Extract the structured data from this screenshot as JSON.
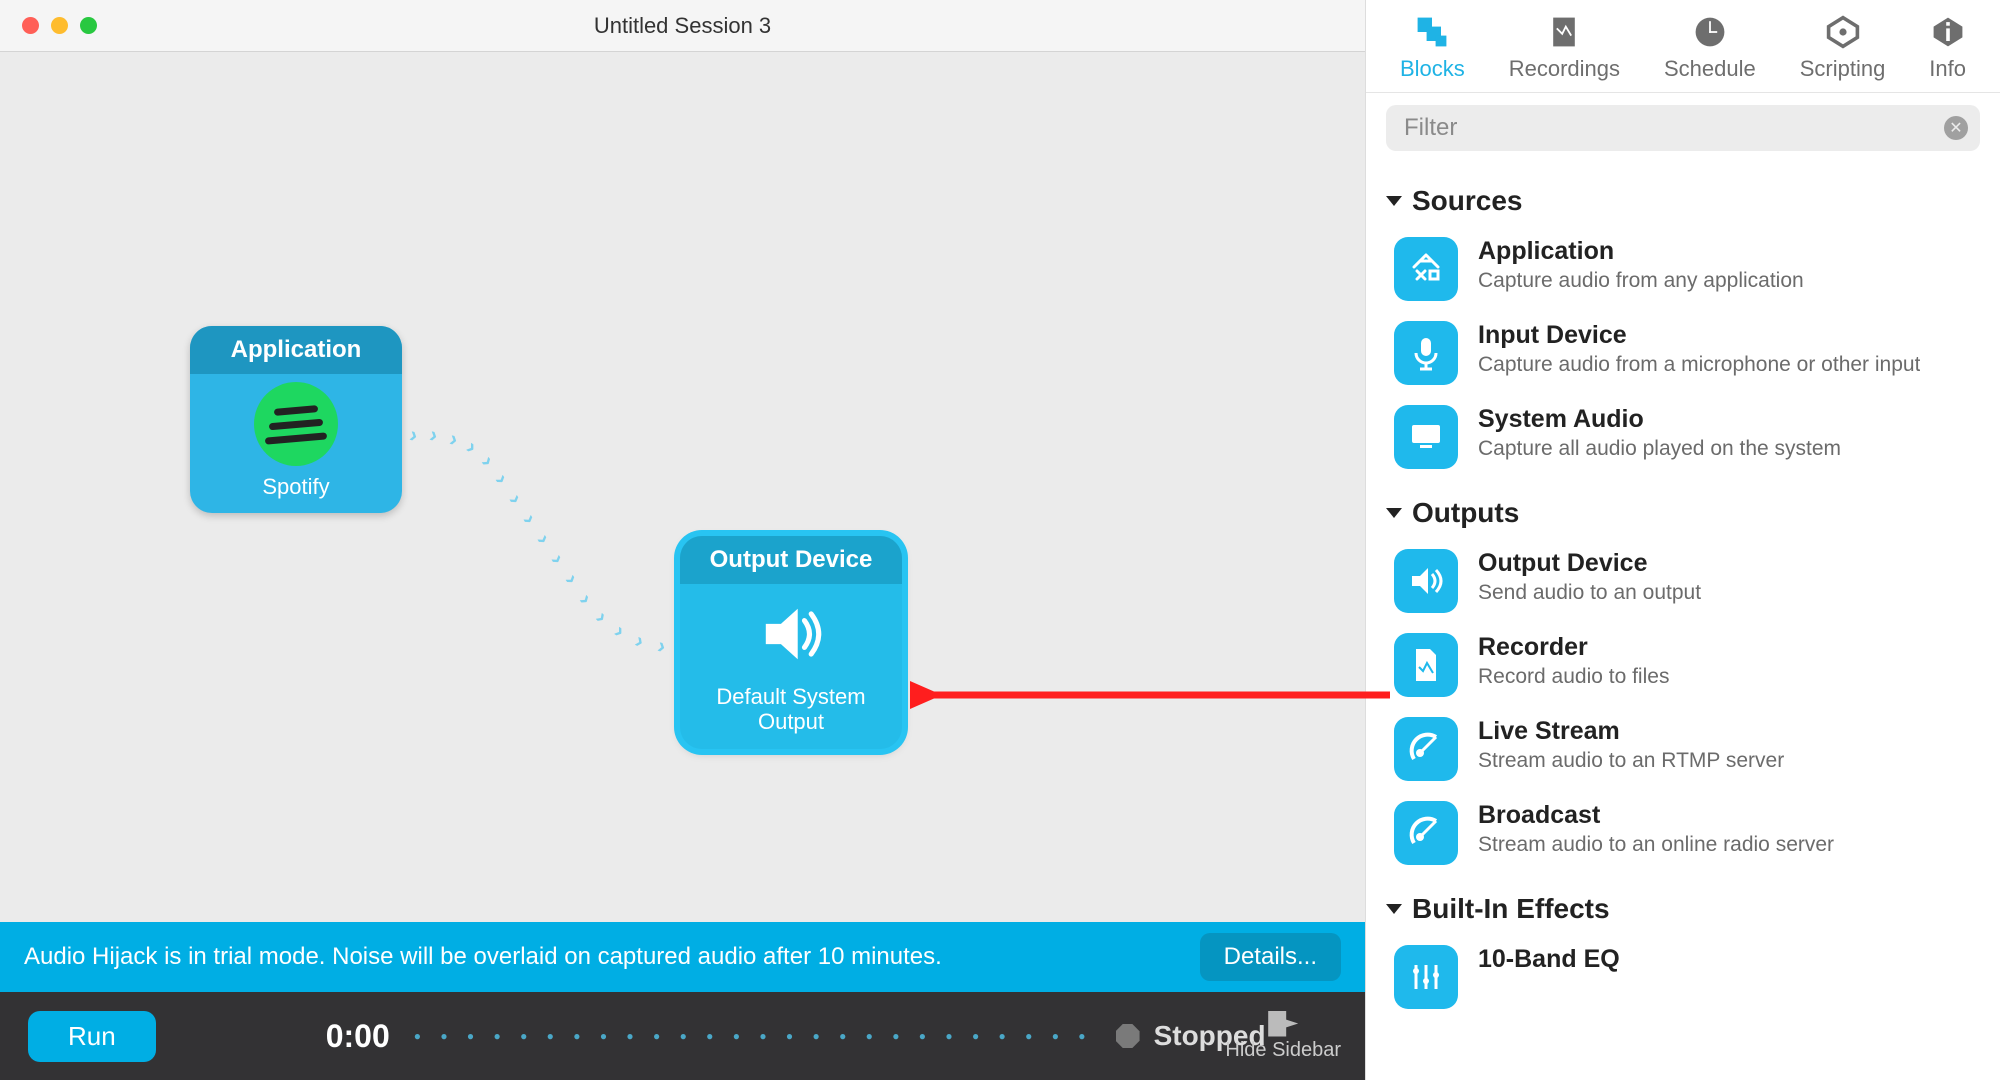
{
  "window": {
    "title": "Untitled Session 3"
  },
  "canvas": {
    "node1": {
      "header": "Application",
      "label": "Spotify"
    },
    "node2": {
      "header": "Output Device",
      "label": "Default System Output"
    }
  },
  "trial_bar": {
    "message": "Audio Hijack is in trial mode. Noise will be overlaid on captured audio after 10 minutes.",
    "details_label": "Details..."
  },
  "control_bar": {
    "run_label": "Run",
    "time": "0:00",
    "status": "Stopped",
    "hide_sidebar_label": "Hide Sidebar"
  },
  "sidebar_tabs": {
    "blocks": "Blocks",
    "recordings": "Recordings",
    "schedule": "Schedule",
    "scripting": "Scripting",
    "info": "Info"
  },
  "filter": {
    "placeholder": "Filter"
  },
  "sections": {
    "sources": {
      "title": "Sources",
      "items": [
        {
          "title": "Application",
          "desc": "Capture audio from any application"
        },
        {
          "title": "Input Device",
          "desc": "Capture audio from a microphone or other input"
        },
        {
          "title": "System Audio",
          "desc": "Capture all audio played on the system"
        }
      ]
    },
    "outputs": {
      "title": "Outputs",
      "items": [
        {
          "title": "Output Device",
          "desc": "Send audio to an output"
        },
        {
          "title": "Recorder",
          "desc": "Record audio to files"
        },
        {
          "title": "Live Stream",
          "desc": "Stream audio to an RTMP server"
        },
        {
          "title": "Broadcast",
          "desc": "Stream audio to an online radio server"
        }
      ]
    },
    "effects": {
      "title": "Built-In Effects",
      "items": [
        {
          "title": "10-Band EQ",
          "desc": ""
        }
      ]
    }
  }
}
